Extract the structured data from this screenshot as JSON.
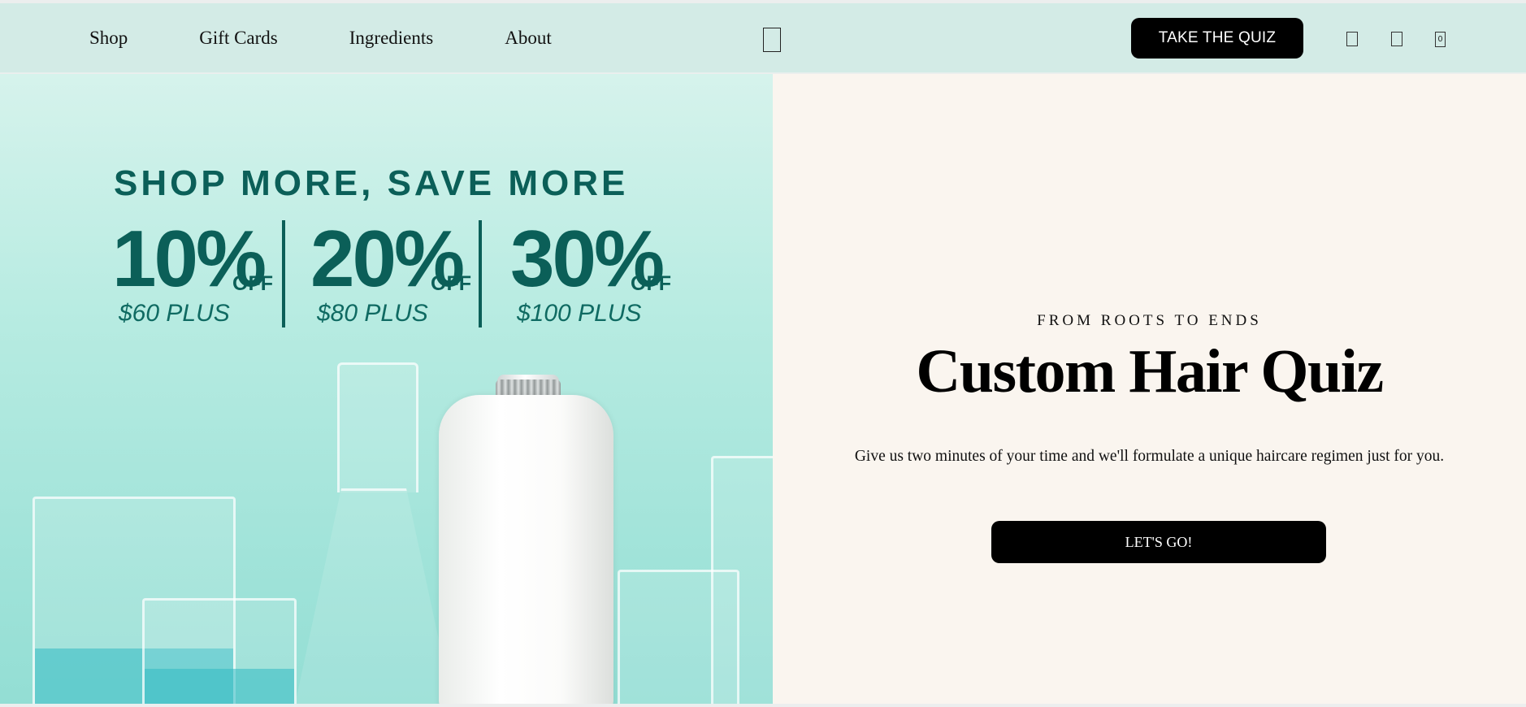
{
  "header": {
    "nav": [
      "Shop",
      "Gift Cards",
      "Ingredients",
      "About"
    ],
    "quiz_button": "TAKE THE QUIZ",
    "cart_count": "0",
    "icons": [
      "logo-icon",
      "search-icon",
      "account-icon",
      "cart-icon"
    ]
  },
  "promo": {
    "headline": "SHOP MORE, SAVE MORE",
    "tiers": [
      {
        "percent": "10%",
        "off": "OFF",
        "minimum": "$60 PLUS"
      },
      {
        "percent": "20%",
        "off": "OFF",
        "minimum": "$80 PLUS"
      },
      {
        "percent": "30%",
        "off": "OFF",
        "minimum": "$100 PLUS"
      }
    ]
  },
  "quiz": {
    "eyebrow": "FROM ROOTS TO ENDS",
    "title": "Custom Hair Quiz",
    "description": "Give us two minutes of your time and we'll formulate a unique haircare regimen just for you.",
    "cta": "LET'S GO!"
  },
  "colors": {
    "header_bg": "#d3ebe6",
    "promo_text": "#0b5f58",
    "panel_bg": "#faf5ef",
    "button_bg": "#000000"
  }
}
